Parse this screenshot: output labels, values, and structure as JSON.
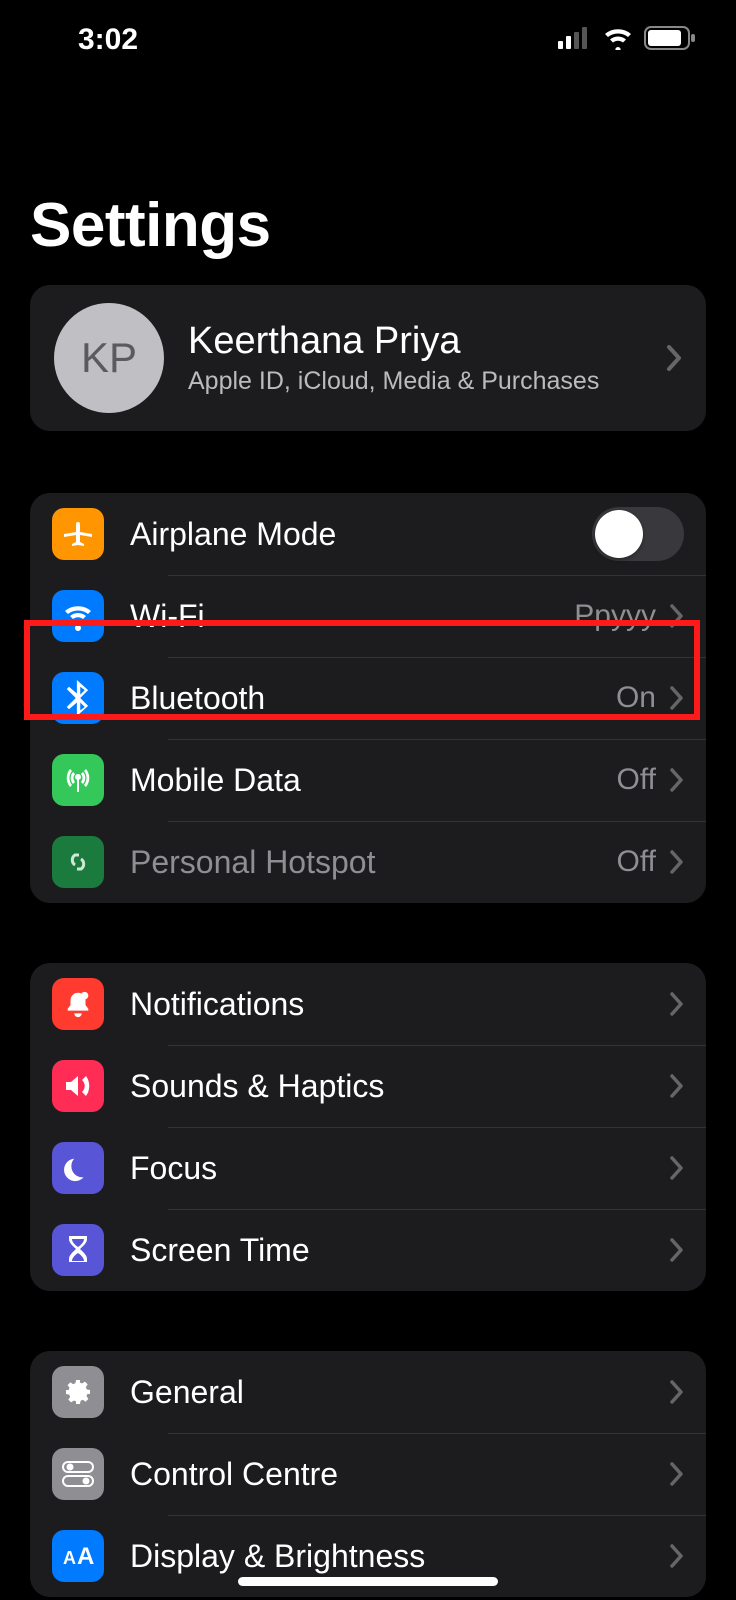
{
  "status": {
    "time": "3:02"
  },
  "title": "Settings",
  "profile": {
    "initials": "KP",
    "name": "Keerthana Priya",
    "subtitle": "Apple ID, iCloud, Media & Purchases"
  },
  "groups": [
    {
      "rows": [
        {
          "key": "airplane",
          "icon": "airplane-icon",
          "iconClass": "ic-orange",
          "label": "Airplane Mode",
          "type": "toggle",
          "value": "off"
        },
        {
          "key": "wifi",
          "icon": "wifi-icon",
          "iconClass": "ic-blue",
          "label": "Wi-Fi",
          "type": "link",
          "value": "Ppyyy"
        },
        {
          "key": "bluetooth",
          "icon": "bluetooth-icon",
          "iconClass": "ic-blue",
          "label": "Bluetooth",
          "type": "link",
          "value": "On"
        },
        {
          "key": "cellular",
          "icon": "antenna-icon",
          "iconClass": "ic-green",
          "label": "Mobile Data",
          "type": "link",
          "value": "Off"
        },
        {
          "key": "hotspot",
          "icon": "link-icon",
          "iconClass": "ic-dgreen",
          "label": "Personal Hotspot",
          "type": "link",
          "value": "Off",
          "dim": true
        }
      ]
    },
    {
      "rows": [
        {
          "key": "notifications",
          "icon": "bell-icon",
          "iconClass": "ic-red",
          "label": "Notifications",
          "type": "link"
        },
        {
          "key": "sounds",
          "icon": "speaker-icon",
          "iconClass": "ic-pink",
          "label": "Sounds & Haptics",
          "type": "link"
        },
        {
          "key": "focus",
          "icon": "moon-icon",
          "iconClass": "ic-indigo",
          "label": "Focus",
          "type": "link"
        },
        {
          "key": "screentime",
          "icon": "hourglass-icon",
          "iconClass": "ic-indigo",
          "label": "Screen Time",
          "type": "link"
        }
      ]
    },
    {
      "rows": [
        {
          "key": "general",
          "icon": "gear-icon",
          "iconClass": "ic-gray",
          "label": "General",
          "type": "link"
        },
        {
          "key": "control",
          "icon": "switches-icon",
          "iconClass": "ic-gray",
          "label": "Control Centre",
          "type": "link"
        },
        {
          "key": "display",
          "icon": "text-size-icon",
          "iconClass": "ic-blue",
          "label": "Display & Brightness",
          "type": "link"
        }
      ]
    }
  ],
  "highlight": {
    "targetKey": "bluetooth"
  }
}
